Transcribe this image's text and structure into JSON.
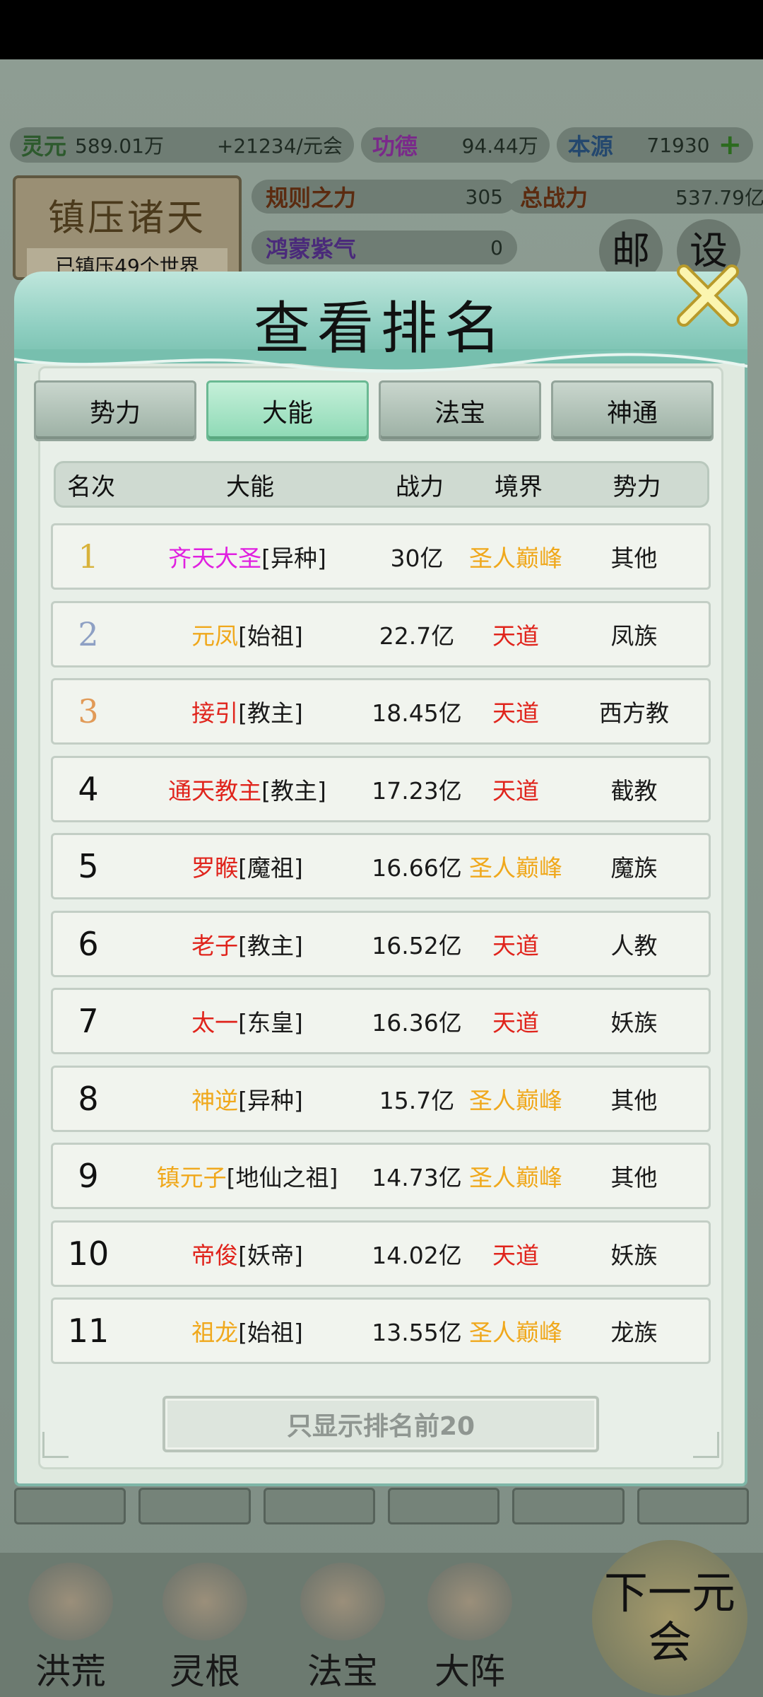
{
  "hud": {
    "lingyuan_label": "灵元",
    "lingyuan_value": "589.01万",
    "lingyuan_rate": "+21234/元会",
    "gongde_label": "功德",
    "gongde_value": "94.44万",
    "benyuan_label": "本源",
    "benyuan_value": "71930",
    "banner_title": "镇压诸天",
    "banner_subtitle": "已镇压49个世界",
    "rules_label": "规则之力",
    "rules_value": "305",
    "total_power_label": "总战力",
    "total_power_value": "537.79亿",
    "hongmeng_label": "鸿蒙紫气",
    "hongmeng_value": "0",
    "mail_label": "邮",
    "settings_label": "设"
  },
  "modal": {
    "title": "查看排名",
    "tabs": [
      "势力",
      "大能",
      "法宝",
      "神通"
    ],
    "active_tab": "大能",
    "columns": [
      "名次",
      "大能",
      "战力",
      "境界",
      "势力"
    ],
    "footer_button": "只显示排名前20"
  },
  "ranking": [
    {
      "rank": "1",
      "name": "齐天大圣",
      "name_color": "#e020e0",
      "title": "[异种]",
      "power": "30亿",
      "realm": "圣人巅峰",
      "realm_type": "peak",
      "faction": "其他"
    },
    {
      "rank": "2",
      "name": "元凤",
      "name_color": "#f0a81c",
      "title": "[始祖]",
      "power": "22.7亿",
      "realm": "天道",
      "realm_type": "dao",
      "faction": "凤族"
    },
    {
      "rank": "3",
      "name": "接引",
      "name_color": "#e0241c",
      "title": "[教主]",
      "power": "18.45亿",
      "realm": "天道",
      "realm_type": "dao",
      "faction": "西方教"
    },
    {
      "rank": "4",
      "name": "通天教主",
      "name_color": "#e0241c",
      "title": "[教主]",
      "power": "17.23亿",
      "realm": "天道",
      "realm_type": "dao",
      "faction": "截教"
    },
    {
      "rank": "5",
      "name": "罗睺",
      "name_color": "#e0241c",
      "title": "[魔祖]",
      "power": "16.66亿",
      "realm": "圣人巅峰",
      "realm_type": "peak",
      "faction": "魔族"
    },
    {
      "rank": "6",
      "name": "老子",
      "name_color": "#e0241c",
      "title": "[教主]",
      "power": "16.52亿",
      "realm": "天道",
      "realm_type": "dao",
      "faction": "人教"
    },
    {
      "rank": "7",
      "name": "太一",
      "name_color": "#e0241c",
      "title": "[东皇]",
      "power": "16.36亿",
      "realm": "天道",
      "realm_type": "dao",
      "faction": "妖族"
    },
    {
      "rank": "8",
      "name": "神逆",
      "name_color": "#f0a81c",
      "title": "[异种]",
      "power": "15.7亿",
      "realm": "圣人巅峰",
      "realm_type": "peak",
      "faction": "其他"
    },
    {
      "rank": "9",
      "name": "镇元子",
      "name_color": "#f0a81c",
      "title": "[地仙之祖]",
      "power": "14.73亿",
      "realm": "圣人巅峰",
      "realm_type": "peak",
      "faction": "其他"
    },
    {
      "rank": "10",
      "name": "帝俊",
      "name_color": "#e0241c",
      "title": "[妖帝]",
      "power": "14.02亿",
      "realm": "天道",
      "realm_type": "dao",
      "faction": "妖族"
    },
    {
      "rank": "11",
      "name": "祖龙",
      "name_color": "#f0a81c",
      "title": "[始祖]",
      "power": "13.55亿",
      "realm": "圣人巅峰",
      "realm_type": "peak",
      "faction": "龙族"
    }
  ],
  "bottom_nav": [
    "洪荒",
    "灵根",
    "法宝",
    "大阵"
  ],
  "next_button": "下一元会"
}
